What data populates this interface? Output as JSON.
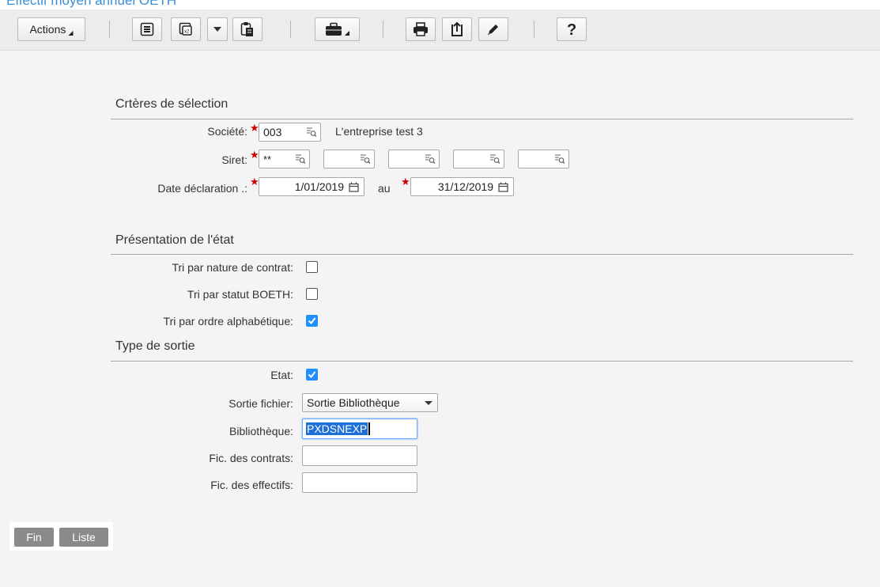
{
  "window": {
    "title": "Effectif moyen annuel OETH"
  },
  "toolbar": {
    "actions_label": "Actions",
    "icons": [
      "list-icon",
      "duplicate-icon",
      "dropdown-arrow-icon",
      "paste-icon",
      "briefcase-icon",
      "print-icon",
      "export-icon",
      "edit-icon",
      "help-icon"
    ]
  },
  "criteria": {
    "section_title": "Crtères de sélection",
    "societe_label": "Société:",
    "societe_value": "003",
    "societe_name": "L'entreprise test 3",
    "siret_label": "Siret:",
    "siret_values": [
      "**",
      "",
      "",
      "",
      ""
    ],
    "date_label": "Date déclaration .:",
    "date_from": "1/01/2019",
    "au_label": "au",
    "date_to": "31/12/2019"
  },
  "presentation": {
    "section_title": "Présentation de l'état",
    "tri_contrat_label": "Tri par nature de contrat:",
    "tri_contrat_checked": false,
    "tri_boeth_label": "Tri par statut BOETH:",
    "tri_boeth_checked": false,
    "tri_alpha_label": "Tri par ordre alphabétique:",
    "tri_alpha_checked": true
  },
  "sortie": {
    "section_title": "Type de sortie",
    "etat_label": "Etat:",
    "etat_checked": true,
    "fichier_label": "Sortie fichier:",
    "fichier_value": "Sortie Bibliothèque",
    "bibliotheque_label": "Bibliothèque:",
    "bibliotheque_value": "PXDSNEXP",
    "contrats_label": "Fic. des contrats:",
    "contrats_value": "",
    "effectifs_label": "Fic. des effectifs:",
    "effectifs_value": ""
  },
  "footer": {
    "fin_label": "Fin",
    "liste_label": "Liste"
  },
  "colors": {
    "accent": "#1e90ff",
    "title": "#3a8fd8",
    "required": "#d10000",
    "button": "#8a8a8a"
  }
}
